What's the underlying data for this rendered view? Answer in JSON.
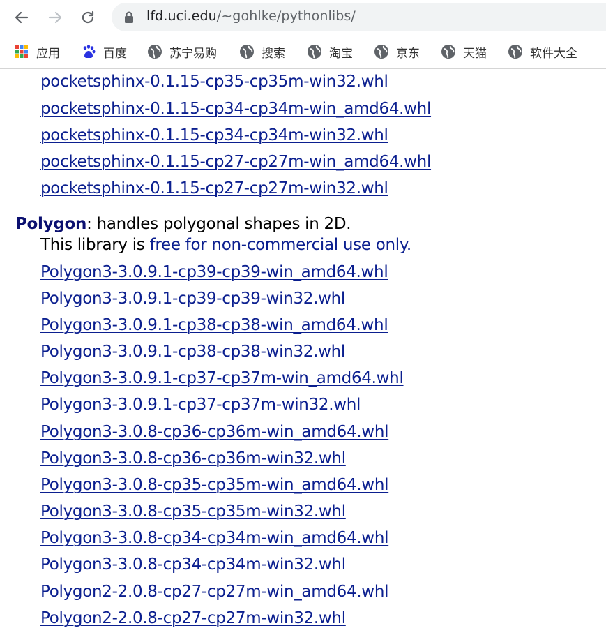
{
  "browser": {
    "url_host": "lfd.uci.edu",
    "url_path": "/~gohlke/pythonlibs/"
  },
  "bookmarks": [
    {
      "label": "应用",
      "icon": "apps-grid-icon"
    },
    {
      "label": "百度",
      "icon": "baidu-paw-icon"
    },
    {
      "label": "苏宁易购",
      "icon": "globe-icon"
    },
    {
      "label": "搜索",
      "icon": "globe-icon"
    },
    {
      "label": "淘宝",
      "icon": "globe-icon"
    },
    {
      "label": "京东",
      "icon": "globe-icon"
    },
    {
      "label": "天猫",
      "icon": "globe-icon"
    },
    {
      "label": "软件大全",
      "icon": "globe-icon"
    }
  ],
  "pocketsphinx_links": [
    "pocketsphinx-0.1.15-cp35-cp35m-win32.whl",
    "pocketsphinx-0.1.15-cp34-cp34m-win_amd64.whl",
    "pocketsphinx-0.1.15-cp34-cp34m-win32.whl",
    "pocketsphinx-0.1.15-cp27-cp27m-win_amd64.whl",
    "pocketsphinx-0.1.15-cp27-cp27m-win32.whl"
  ],
  "polygon": {
    "name": "Polygon",
    "description": ": handles polygonal shapes in 2D.",
    "license_prefix": "This library is ",
    "license_free": "free for non-commercial use only.",
    "links": [
      "Polygon3-3.0.9.1-cp39-cp39-win_amd64.whl",
      "Polygon3-3.0.9.1-cp39-cp39-win32.whl",
      "Polygon3-3.0.9.1-cp38-cp38-win_amd64.whl",
      "Polygon3-3.0.9.1-cp38-cp38-win32.whl",
      "Polygon3-3.0.9.1-cp37-cp37m-win_amd64.whl",
      "Polygon3-3.0.9.1-cp37-cp37m-win32.whl",
      "Polygon3-3.0.8-cp36-cp36m-win_amd64.whl",
      "Polygon3-3.0.8-cp36-cp36m-win32.whl",
      "Polygon3-3.0.8-cp35-cp35m-win_amd64.whl",
      "Polygon3-3.0.8-cp35-cp35m-win32.whl",
      "Polygon3-3.0.8-cp34-cp34m-win_amd64.whl",
      "Polygon3-3.0.8-cp34-cp34m-win32.whl",
      "Polygon2-2.0.8-cp27-cp27m-win_amd64.whl",
      "Polygon2-2.0.8-cp27-cp27m-win32.whl"
    ]
  },
  "colors": {
    "link": "#0b1f8f",
    "package_name": "#0b1070",
    "omnibox": "#f1f3f4"
  }
}
